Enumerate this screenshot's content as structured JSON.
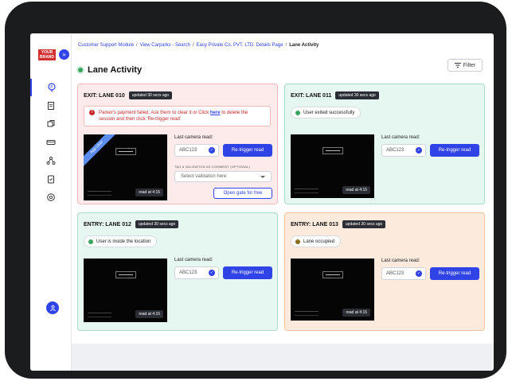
{
  "brand": {
    "logo_line1": "YOUR",
    "logo_line2": "BRAND"
  },
  "breadcrumb": [
    "Customer Support Module",
    "View Carparks - Search",
    "Easy Private Co. PVT. LTD. Details Page",
    "Lane Activity"
  ],
  "breadcrumb_sep": "/",
  "page": {
    "title": "Lane Activity",
    "filter_label": "Filter"
  },
  "colors": {
    "accent": "#2f43e6",
    "success": "#3aa55d",
    "error": "#c62828",
    "warning": "#8a6d1e"
  },
  "sidebar_icons": [
    "parking-icon",
    "document-icon",
    "money-icon",
    "cards-icon",
    "network-icon",
    "clipboard-icon",
    "settings-icon"
  ],
  "lanes": [
    {
      "name": "EXIT: LANE 010",
      "updated": "updated 30 secs ago",
      "alert": {
        "text_before": "Parker's payment failed. Ask them to clear it or Click ",
        "link": "here",
        "text_after": " to delete the session and then click 'Re-trigger read'"
      },
      "ribbon": "App User",
      "read_at": "read at 4:15",
      "camera_label": "Last camera read:",
      "plate": "ABC123",
      "retrigger_label": "Re-trigger read",
      "validation_label": "TAG A VALIDATION AS COMMENT (OPTIONAL)",
      "validation_placeholder": "Select validation here",
      "open_gate_label": "Open gate for free"
    },
    {
      "name": "EXIT: LANE 011",
      "updated": "updated 30 secs ago",
      "status": "User exited successfully",
      "read_at": "read at 4:15",
      "camera_label": "Last camera read:",
      "plate": "ABC123",
      "retrigger_label": "Re-trigger read"
    },
    {
      "name": "ENTRY: LANE 012",
      "updated": "updated 30 secs ago",
      "status": "User is inside the location",
      "read_at": "read at 4:15",
      "camera_label": "Last camera read:",
      "plate": "ABC123",
      "retrigger_label": "Re-trigger read"
    },
    {
      "name": "ENTRY: LANE 013",
      "updated": "updated 30 secs ago",
      "status": "Lane occupied",
      "read_at": "read at 4:15",
      "camera_label": "Last camera read:",
      "plate": "ABC123",
      "retrigger_label": "Re-trigger read"
    }
  ]
}
